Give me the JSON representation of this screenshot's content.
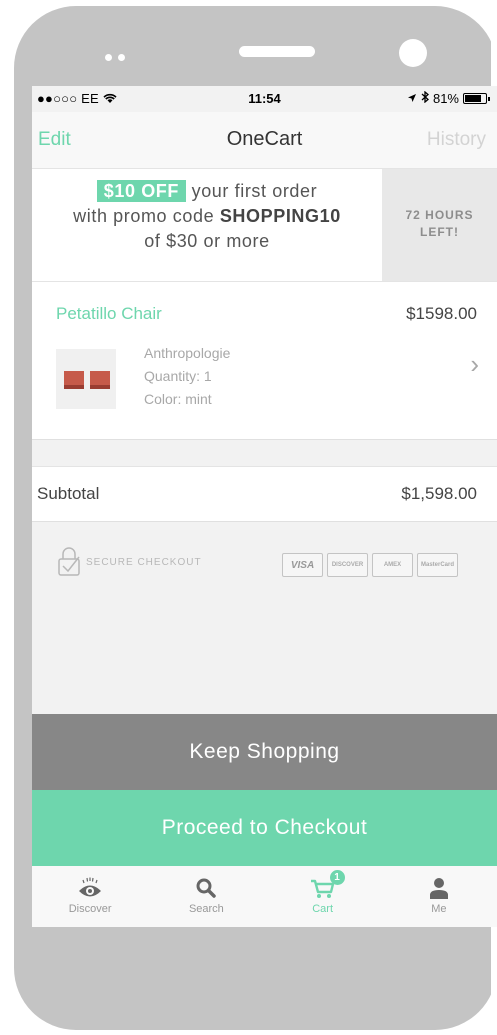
{
  "status_bar": {
    "carrier": "●●○○○ EE",
    "time": "11:54",
    "battery": "81%",
    "battery_level": 0.81
  },
  "nav": {
    "left": "Edit",
    "title": "OneCart",
    "right": "History"
  },
  "promo": {
    "badge": "$10 OFF",
    "line1_rest": " your first order",
    "line2_prefix": "with promo code ",
    "code": "SHOPPING10",
    "line3": "of $30 or more",
    "timer_line1": "72 HOURS",
    "timer_line2": "LEFT!"
  },
  "cart_item": {
    "name": "Petatillo Chair",
    "price": "$1598.00",
    "store": "Anthropologie",
    "quantity": "Quantity: 1",
    "color": "Color: mint"
  },
  "subtotal": {
    "label": "Subtotal",
    "value": "$1,598.00"
  },
  "secure_checkout": {
    "label": "SECURE CHECKOUT",
    "cards": [
      "VISA",
      "DISCOVER",
      "AMEX",
      "MasterCard"
    ]
  },
  "buttons": {
    "keep_shopping": "Keep Shopping",
    "checkout": "Proceed to Checkout"
  },
  "tabs": [
    {
      "label": "Discover",
      "icon": "eye-icon"
    },
    {
      "label": "Search",
      "icon": "search-icon"
    },
    {
      "label": "Cart",
      "icon": "cart-icon",
      "badge": "1"
    },
    {
      "label": "Me",
      "icon": "person-icon"
    }
  ],
  "colors": {
    "accent": "#6ed6ad",
    "keep_button": "#878787"
  }
}
